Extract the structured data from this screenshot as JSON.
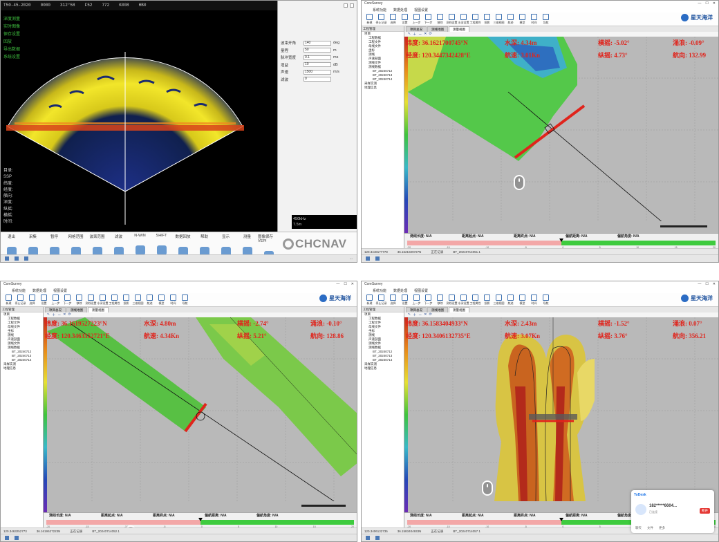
{
  "sonar": {
    "title_text": "...",
    "top_bar": [
      "T50-45-2020",
      "0000",
      "312°58",
      "F52",
      "772",
      "K008",
      "HB0"
    ],
    "menu_items": [
      "深度测量",
      "实时图像",
      "保存设置",
      "回放",
      "导出数据",
      "系统设置"
    ],
    "info_lines": [
      "目录: ",
      "SSP",
      "纬度: ",
      "经度: ",
      "艏向: ",
      "深度: ",
      "纵摇: ",
      "横摇: ",
      "时间: "
    ],
    "side_rows": [
      {
        "label": "波束开角",
        "value": "140",
        "unit": "deg"
      },
      {
        "label": "量程",
        "value": "50",
        "unit": "m"
      },
      {
        "label": "脉冲宽度",
        "value": "0.1",
        "unit": "ms"
      },
      {
        "label": "增益",
        "value": "10",
        "unit": "dB"
      },
      {
        "label": "声速",
        "value": "1500",
        "unit": "m/s"
      },
      {
        "label": "滤波",
        "value": "0",
        "unit": ""
      }
    ],
    "readout": [
      "450kHz",
      "7.5m"
    ],
    "toolbar": [
      "退出",
      "采集",
      "暂停",
      "网格范围",
      "波束范围",
      "滤波",
      "N-WIN",
      "SHIFT",
      "数据回放",
      "帮助",
      "显示",
      "测量",
      "图像保存VEPI",
      "关闭",
      "设置"
    ],
    "brand": "CHCNAV",
    "taskbar_clock": "..."
  },
  "panes": [
    {
      "title": "CoreSurvey",
      "menu": [
        "系统功能",
        "数据处理",
        "视图设置"
      ],
      "ribbon": [
        "新建",
        "停止记录",
        "选择",
        "设置",
        "上一步",
        "下一步",
        "移除",
        "测线设置",
        "水深设置",
        "工程属性",
        "投影",
        "三维视图",
        "航迹",
        "模型",
        "时间",
        "导航"
      ],
      "brand": "星天海洋",
      "tabs": [
        "项目总况",
        "测线地图",
        "测量视图"
      ],
      "tree_header": "工程管理",
      "tree": [
        "项目",
        "工程数据",
        "工程文件",
        "母线文件",
        "坐标",
        "测线",
        "声速剖面",
        "测线文件",
        "测线数据",
        "BT_20240712",
        "BT_20240713",
        "BT_20240714",
        "采样实测",
        "地理信息"
      ],
      "overlay": {
        "lat": "纬度: 36.1621700745°N",
        "lon": "经度: 120.3447342428°E",
        "depth": "水深: 4.34m",
        "speed": "航速: 3.01Kn",
        "roll": "横摇: -5.02°",
        "pitch": "纵摇: 4.73°",
        "heave": "涌浪: -0.09°",
        "heading": "航向: 132.99"
      },
      "status_labels": [
        "测线长度: N/A",
        "距离起点: N/A",
        "距离终点: N/A",
        "偏航距离: N/A",
        "偏航角度: N/A"
      ],
      "scale_ticks": [
        "-20",
        "-15",
        "-10",
        "-5",
        "0",
        "5",
        "10",
        "15",
        "20"
      ],
      "window_status": [
        "120.3448177778",
        "36.1621829727N",
        "正在记录",
        "BT_20240714051.1"
      ]
    },
    {
      "title": "CoreSurvey",
      "menu": [
        "系统功能",
        "数据处理",
        "视图设置"
      ],
      "ribbon": [
        "新建",
        "停止记录",
        "选择",
        "设置",
        "上一步",
        "下一步",
        "移除",
        "测线设置",
        "水深设置",
        "工程属性",
        "投影",
        "三维视图",
        "航迹",
        "模型",
        "时间",
        "导航"
      ],
      "brand": "星天海洋",
      "tabs": [
        "项目总况",
        "测线地图",
        "测量视图"
      ],
      "tree_header": "工程管理",
      "tree": [
        "项目",
        "工程数据",
        "工程文件",
        "母线文件",
        "坐标",
        "测线",
        "声速剖面",
        "测线文件",
        "测线数据",
        "BT_20240712",
        "BT_20240713",
        "BT_20240714",
        "采样实测",
        "地理信息"
      ],
      "overlay": {
        "lat": "纬度: 36.1619527223°N",
        "lon": "经度: 120.3463352721°E",
        "depth": "水深: 4.80m",
        "speed": "航速: 4.34Kn",
        "roll": "横摇: -2.74°",
        "pitch": "纵摇: 5.21°",
        "heave": "涌浪: -0.10°",
        "heading": "航向: 128.86"
      },
      "status_labels": [
        "测线长度: N/A",
        "距离起点: N/A",
        "距离终点: N/A",
        "偏航距离: N/A",
        "偏航角度: N/A"
      ],
      "scale_ticks": [
        "-20",
        "-15",
        "-10",
        "-5",
        "0",
        "5",
        "10",
        "15",
        "20"
      ],
      "window_status": [
        "120.3463252773",
        "36.1619527223N",
        "正在记录",
        "BT_20240714052.1"
      ]
    },
    {
      "title": "CoreSurvey",
      "menu": [
        "系统功能",
        "数据处理",
        "视图设置"
      ],
      "ribbon": [
        "新建",
        "停止记录",
        "选择",
        "设置",
        "上一步",
        "下一步",
        "移除",
        "测线设置",
        "水深设置",
        "工程属性",
        "投影",
        "三维视图",
        "航迹",
        "模型",
        "时间",
        "导航"
      ],
      "brand": "星天海洋",
      "tabs": [
        "项目总况",
        "测线地图",
        "测量视图"
      ],
      "tree_header": "工程管理",
      "tree": [
        "项目",
        "工程数据",
        "工程文件",
        "母线文件",
        "坐标",
        "测线",
        "声速剖面",
        "测线文件",
        "测线数据",
        "BT_20240712",
        "BT_20240713",
        "BT_20240714",
        "采样实测",
        "地理信息"
      ],
      "overlay": {
        "lat": "纬度: 36.1583404933°N",
        "lon": "经度: 120.3406132735°E",
        "depth": "水深: 2.43m",
        "speed": "航速: 3.07Kn",
        "roll": "横摇: -1.52°",
        "pitch": "纵摇: 3.76°",
        "heave": "涌浪: 0.07°",
        "heading": "航向: 356.21"
      },
      "status_labels": [
        "测线长度: N/A",
        "距离起点: N/A",
        "距离终点: N/A",
        "偏航距离: N/A",
        "偏航角度: N/A"
      ],
      "scale_ticks": [
        "-20",
        "-15",
        "-10",
        "-5",
        "0",
        "5",
        "10",
        "15",
        "20"
      ],
      "window_status": [
        "120.3406132735",
        "36.1583404933N",
        "正在记录",
        "BT_20240714057.1"
      ],
      "todesk": {
        "header": "ToDesk",
        "name": "182*****6604...",
        "sub": "已连接",
        "end": "断开",
        "footer": [
          "聊天",
          "文件",
          "更多"
        ]
      }
    }
  ]
}
